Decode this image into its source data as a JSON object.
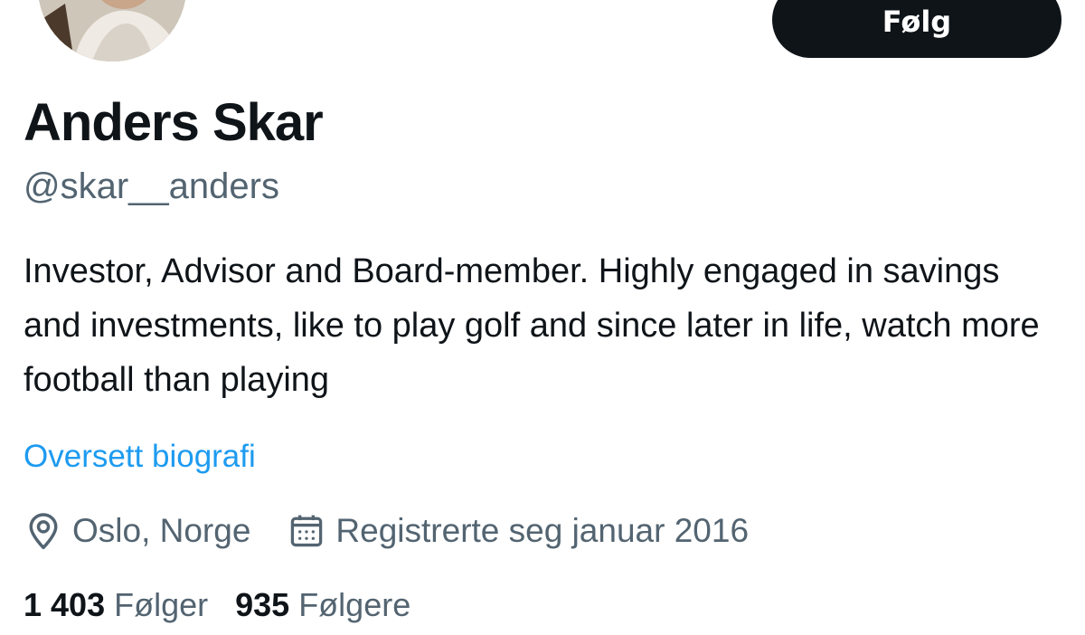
{
  "profile": {
    "display_name": "Anders Skar",
    "handle": "@skar__anders",
    "bio": "Investor, Advisor and Board-member. Highly engaged in savings and investments, like to play golf and since later in life, watch more football than playing",
    "translate_bio_label": "Oversett biografi",
    "location": "Oslo, Norge",
    "joined": "Registrerte seg januar 2016",
    "location_icon": "location-pin-icon",
    "calendar_icon": "calendar-icon"
  },
  "actions": {
    "follow_label": "Følg"
  },
  "stats": {
    "following_count": "1 403",
    "following_label": "Følger",
    "followers_count": "935",
    "followers_label": "Følgere"
  },
  "colors": {
    "text_primary": "#0f1419",
    "text_secondary": "#536471",
    "link": "#1d9bf0",
    "button_bg": "#0f1419",
    "button_text": "#ffffff"
  }
}
